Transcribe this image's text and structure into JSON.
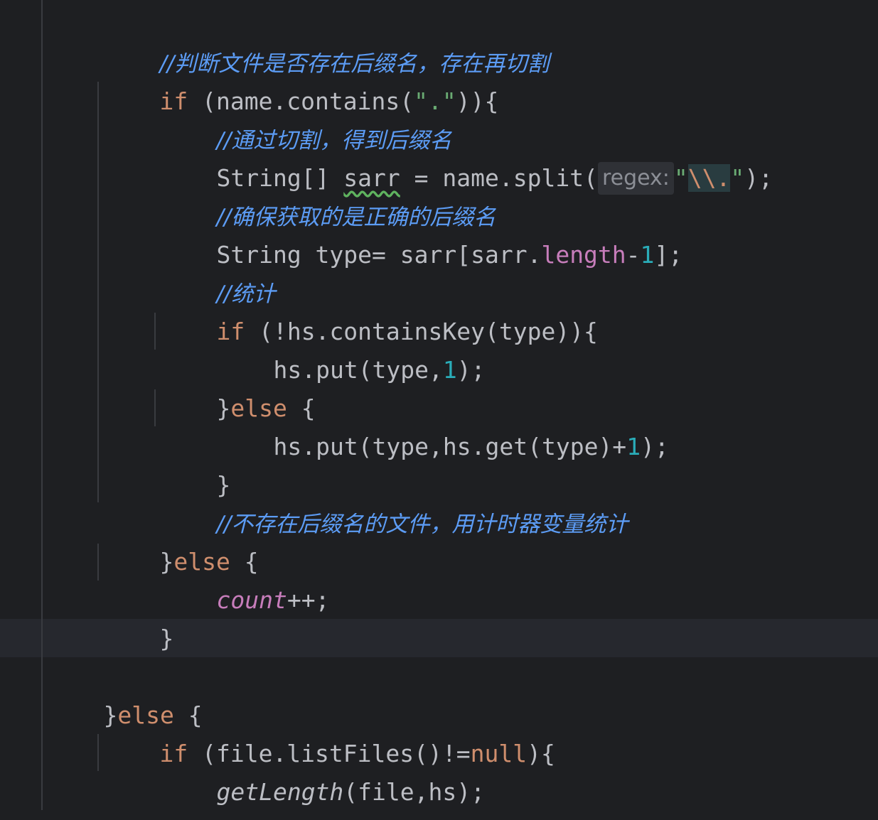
{
  "editor": {
    "lines": {
      "c1": "//判断文件是否存在后缀名，存在再切割",
      "l2_kw": "if",
      "l2_a": " (name.contains(",
      "l2_str": "\".\"",
      "l2_b": ")){",
      "c3": "//通过切割，得到后缀名",
      "l4_a": "String[] ",
      "l4_var": "sarr",
      "l4_b": " = name.split(",
      "l4_hint": "regex:",
      "l4_q1": "\"",
      "l4_esc": "\\\\.",
      "l4_q2": "\"",
      "l4_c": ");",
      "c5": "//确保获取的是正确的后缀名",
      "l6_a": "String type= sarr[sarr.",
      "l6_field": "length",
      "l6_b": "-",
      "l6_num": "1",
      "l6_c": "];",
      "c7": "//统计",
      "l8_kw": "if",
      "l8_a": " (!hs.containsKey(type)){",
      "l9_a": "hs.put(type,",
      "l9_num": "1",
      "l9_b": ");",
      "l10_a": "}",
      "l10_kw": "else",
      "l10_b": " {",
      "l11_a": "hs.put(type,hs.get(type)+",
      "l11_num": "1",
      "l11_b": ");",
      "l12": "}",
      "c13": "//不存在后缀名的文件，用计时器变量统计",
      "l14_a": "}",
      "l14_kw": "else",
      "l14_b": " {",
      "l15_field": "count",
      "l15_b": "++;",
      "l16": "}",
      "l18_a": "}",
      "l18_kw": "else",
      "l18_b": " {",
      "l19_kw": "if",
      "l19_a": " (file.listFiles()!=",
      "l19_null": "null",
      "l19_b": "){",
      "l20_fn": "getLength",
      "l20_a": "(file,hs);",
      "l21": "}"
    }
  },
  "colors": {
    "background": "#1e1f22",
    "keyword": "#cf8e6d",
    "string": "#6aab73",
    "number": "#2aacb8",
    "field": "#c77dbb",
    "comment": "#5c9cf5",
    "text": "#bcbec4"
  }
}
